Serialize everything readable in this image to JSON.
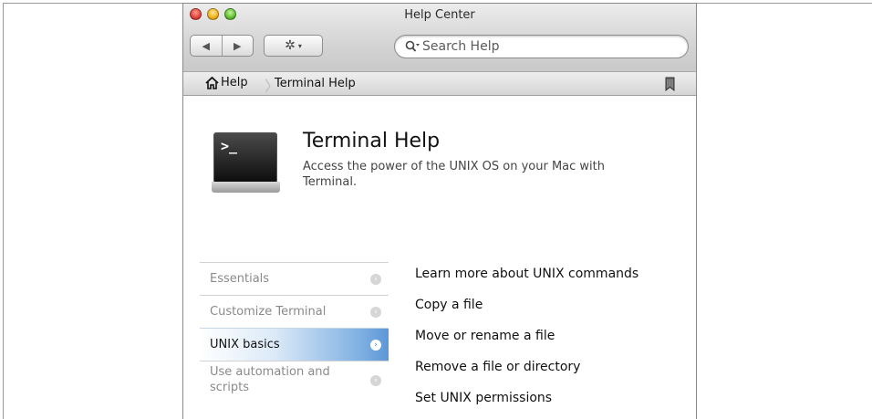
{
  "window": {
    "title": "Help Center"
  },
  "toolbar": {
    "back_glyph": "◀",
    "forward_glyph": "▶",
    "action_glyph": "✲",
    "action_caret": "▾",
    "search_placeholder": "Search Help"
  },
  "breadcrumb": {
    "home_label": "Help",
    "separator": "〉",
    "current": "Terminal Help"
  },
  "header": {
    "app_icon_prompt": ">_",
    "title": "Terminal Help",
    "description": "Access the power of the UNIX OS on your Mac with Terminal."
  },
  "topics": [
    {
      "label": "Essentials",
      "selected": false
    },
    {
      "label": "Customize Terminal",
      "selected": false
    },
    {
      "label": "UNIX basics",
      "selected": true
    },
    {
      "label": "Use automation and scripts",
      "selected": false
    }
  ],
  "links": [
    "Learn more about UNIX commands",
    "Copy a file",
    "Move or rename a file",
    "Remove a file or directory",
    "Set UNIX permissions"
  ],
  "colors": {
    "selection_blue": "#5d97d6",
    "traffic_red": "#e0443a",
    "traffic_yellow": "#f2b21c",
    "traffic_green": "#62c032"
  },
  "icons": {
    "chevron": "›"
  }
}
